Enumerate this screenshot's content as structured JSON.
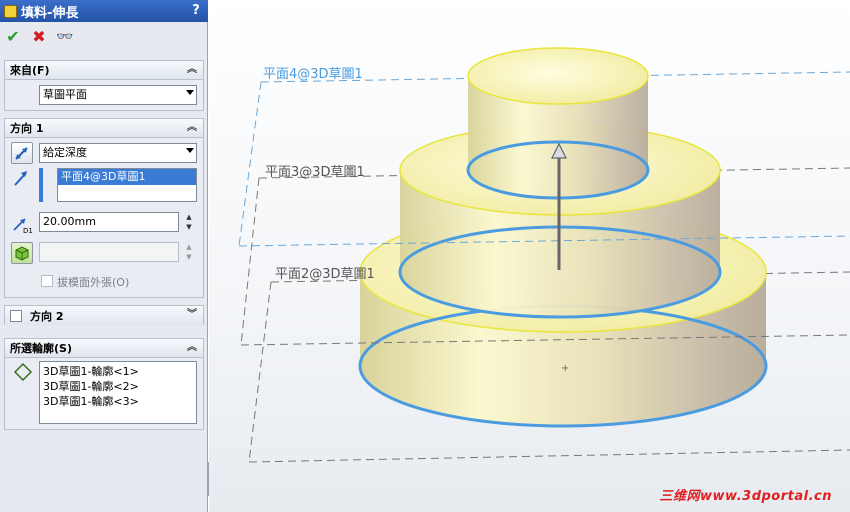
{
  "window": {
    "title": "填料-伸長",
    "help": "?"
  },
  "actions": {
    "ok": "✔",
    "cancel": "✖",
    "preview": "👓"
  },
  "groups": {
    "from": {
      "title": "來自(F)",
      "value": "草圖平面"
    },
    "direction1": {
      "title": "方向 1",
      "end_condition": "給定深度",
      "selected_plane": "平面4@3D草圖1",
      "depth": "20.00mm",
      "draft_label": "拔模面外張(O)"
    },
    "direction2": {
      "title": "方向 2"
    },
    "contours": {
      "title": "所選輪廓(S)",
      "items": [
        "3D草圖1-輪廓<1>",
        "3D草圖1-輪廓<2>",
        "3D草圖1-輪廓<3>"
      ]
    }
  },
  "viewport": {
    "plane_labels": [
      "平面4@3D草圖1",
      "平面3@3D草圖1",
      "平面2@3D草圖1"
    ],
    "watermark": "三维网www.3dportal.cn"
  },
  "colors": {
    "accent": "#3a7bd5",
    "edge_yellow": "#e8e63a",
    "contour_blue": "#4a9be0",
    "plane_blue": "#6aa8d8"
  }
}
